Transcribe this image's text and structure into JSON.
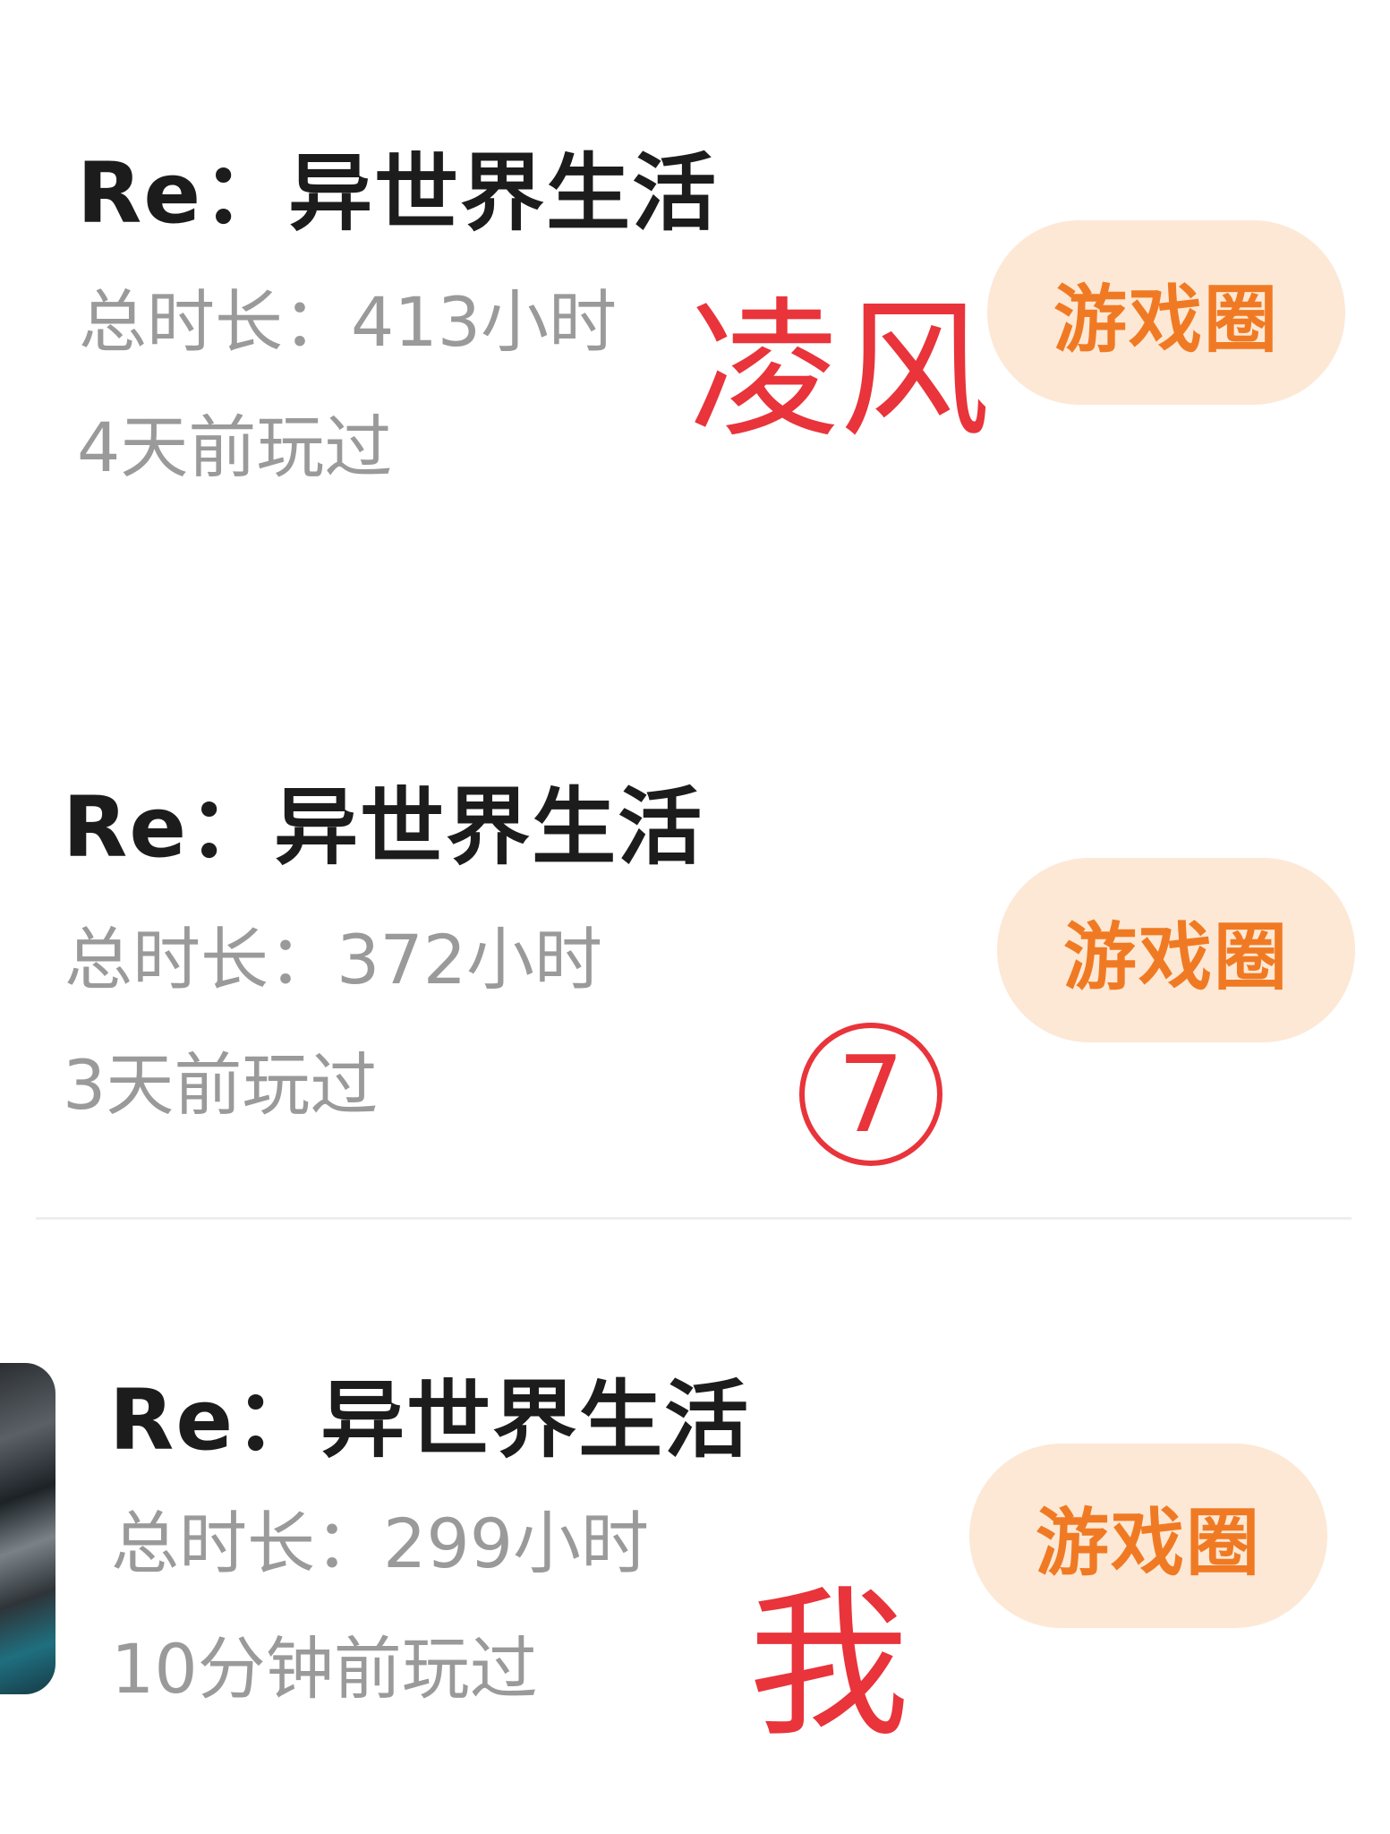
{
  "items": [
    {
      "title": "Re：异世界生活",
      "total_time": "总时长：413小时",
      "last_played": "4天前玩过",
      "circle_button": "游戏圈",
      "annotation": "凌风"
    },
    {
      "title": "Re：异世界生活",
      "total_time": "总时长：372小时",
      "last_played": "3天前玩过",
      "circle_button": "游戏圈",
      "annotation": "7"
    },
    {
      "title": "Re：异世界生活",
      "total_time": "总时长：299小时",
      "last_played": "10分钟前玩过",
      "circle_button": "游戏圈",
      "annotation": "我"
    }
  ],
  "colors": {
    "accent": "#f07a23",
    "button_bg": "#fde8d6",
    "annotation_red": "#e8343a",
    "meta_gray": "#9a9a9a"
  }
}
